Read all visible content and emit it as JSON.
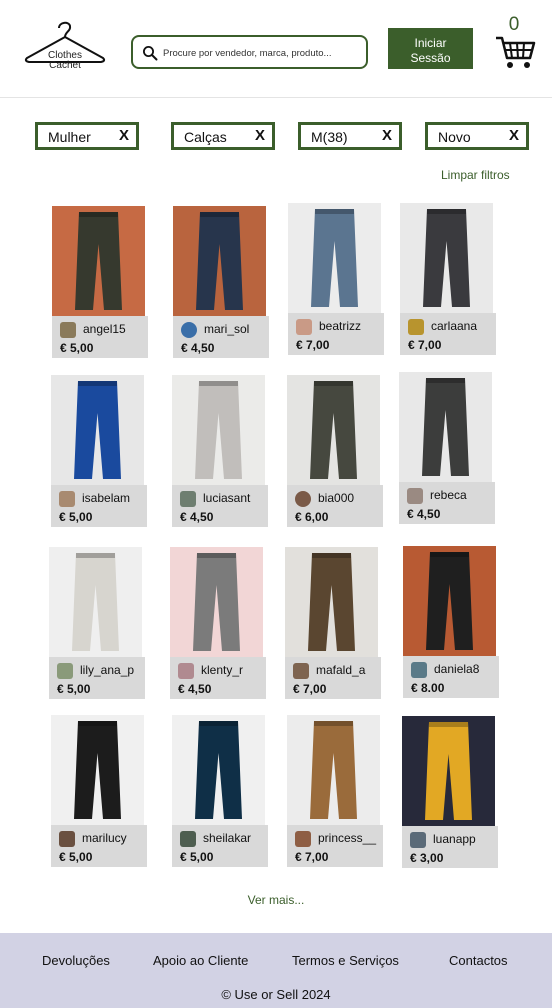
{
  "header": {
    "logo_line1": "Clothes",
    "logo_line2": "Cachet",
    "search_placeholder": "Procure por vendedor, marca, produto...",
    "login_line1": "Iniciar",
    "login_line2": "Sessão",
    "cart_count": "0"
  },
  "filters": [
    "Mulher",
    "Calças",
    "M(38)",
    "Novo"
  ],
  "filter_remove": "X",
  "clear_filters": "Limpar filtros",
  "products": [
    {
      "user": "angel15",
      "price": "€ 5,00",
      "colour": "#36392e",
      "bg": "#c66a44"
    },
    {
      "user": "mari_sol",
      "price": "€ 4,50",
      "colour": "#27354c",
      "bg": "#b9643e"
    },
    {
      "user": "beatrizz",
      "price": "€ 7,00",
      "colour": "#5b7590",
      "bg": "#ececec"
    },
    {
      "user": "carlaana",
      "price": "€ 7,00",
      "colour": "#3a3a3e",
      "bg": "#e9e9e9"
    },
    {
      "user": "isabelam",
      "price": "€ 5,00",
      "colour": "#1a4a9e",
      "bg": "#e7e7e7"
    },
    {
      "user": "luciasant",
      "price": "€ 4,50",
      "colour": "#c1bebb",
      "bg": "#ebebe9"
    },
    {
      "user": "bia000",
      "price": "€ 6,00",
      "colour": "#46483f",
      "bg": "#e4e4e2"
    },
    {
      "user": "rebeca",
      "price": "€ 4,50",
      "colour": "#3c3d3c",
      "bg": "#e8e8e8"
    },
    {
      "user": "lily_ana_p",
      "price": "€ 5,00",
      "colour": "#d7d5cf",
      "bg": "#efefef"
    },
    {
      "user": "klenty_r",
      "price": "€ 4,50",
      "colour": "#7b7b7b",
      "bg": "#f2d6d6"
    },
    {
      "user": "mafald_a",
      "price": "€ 7,00",
      "colour": "#5a4630",
      "bg": "#e2e0dc"
    },
    {
      "user": "daniela8",
      "price": "€ 8.00",
      "colour": "#1f1f1f",
      "bg": "#b85a33"
    },
    {
      "user": "marilucy",
      "price": "€ 5,00",
      "colour": "#1c1c1c",
      "bg": "#f0f0f0"
    },
    {
      "user": "sheilakar",
      "price": "€ 5,00",
      "colour": "#0f2f47",
      "bg": "#f0f0f0"
    },
    {
      "user": "princess__",
      "price": "€ 7,00",
      "colour": "#9a6b3b",
      "bg": "#ececec"
    },
    {
      "user": "luanapp",
      "price": "€ 3,00",
      "colour": "#e2a824",
      "bg": "#27293a"
    }
  ],
  "see_more": "Ver mais...",
  "footer": {
    "links": [
      "Devoluções",
      "Apoio ao Cliente",
      "Termos e Serviços",
      "Contactos"
    ],
    "copyright": "© Use or Sell 2024"
  },
  "colors": {
    "accent": "#3b5e2b",
    "footer_bg": "#d2d2e4",
    "card_info_bg": "#d9d9d9"
  },
  "icons": {
    "search": "search-icon",
    "cart": "cart-icon",
    "logo": "hanger-icon"
  }
}
